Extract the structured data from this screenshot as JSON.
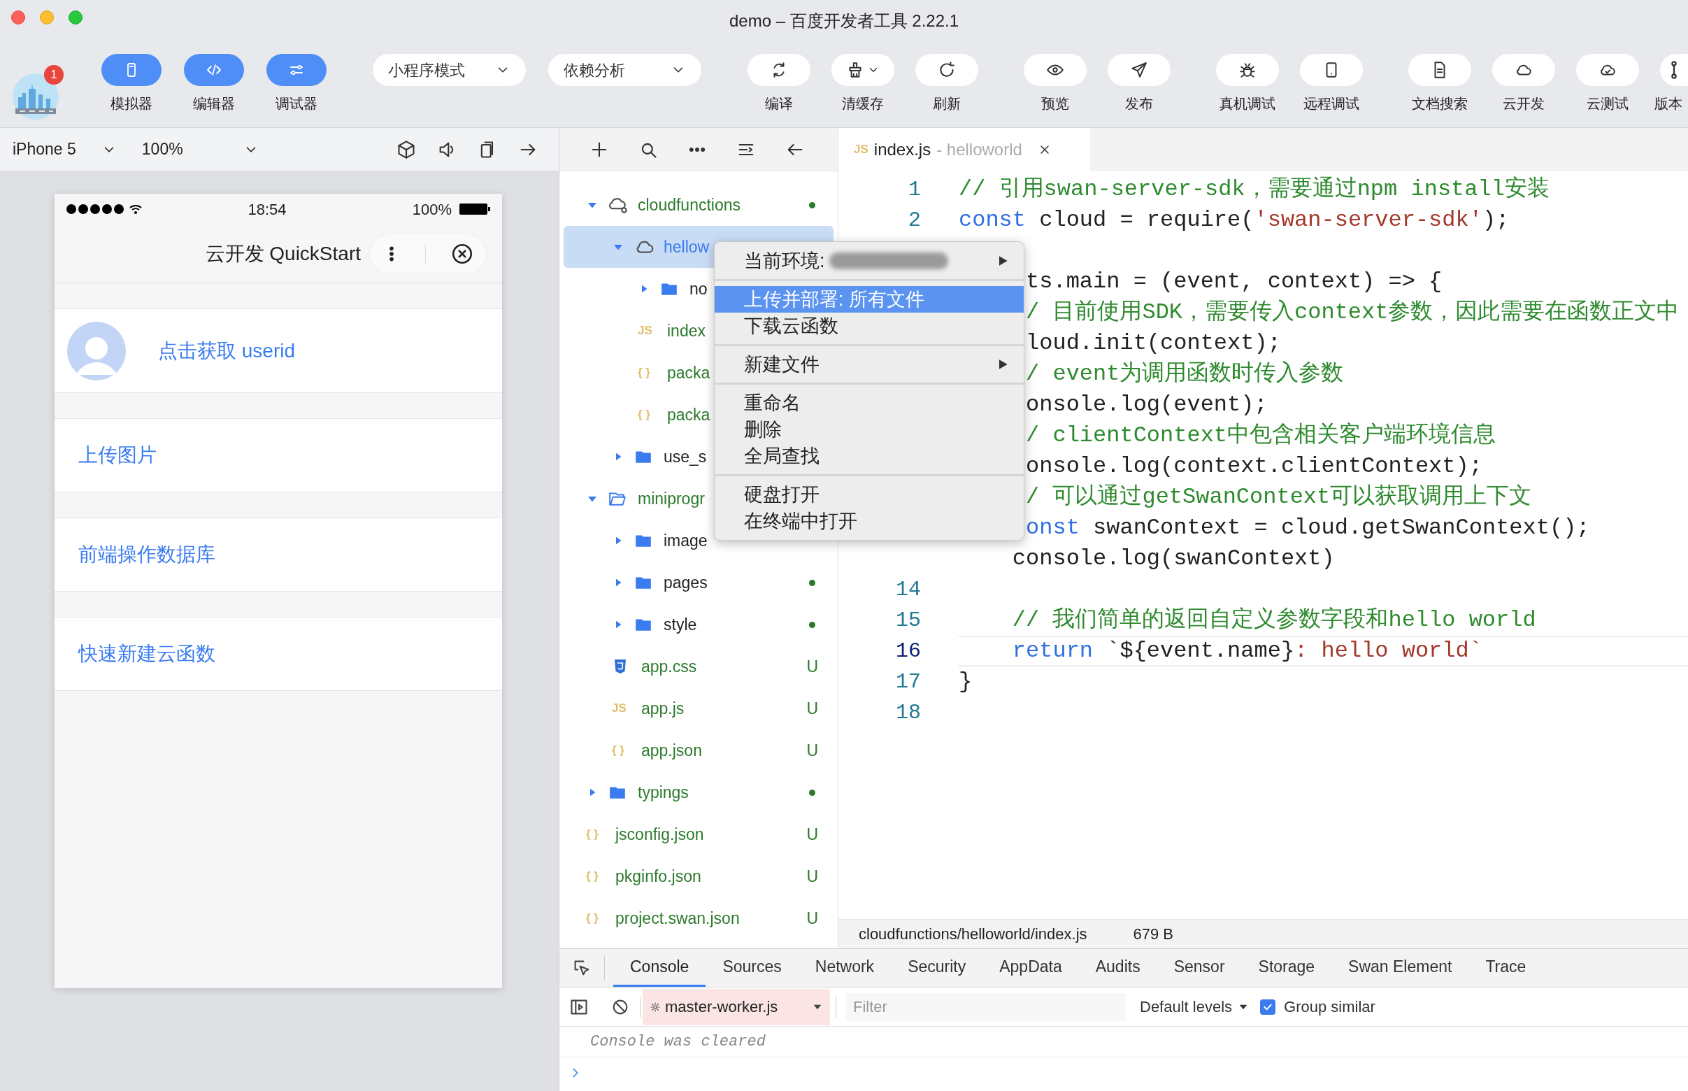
{
  "window": {
    "title": "demo – 百度开发者工具 2.22.1"
  },
  "toolbar": {
    "avatar_badge": "1",
    "toggles": [
      {
        "label": "模拟器",
        "on": true
      },
      {
        "label": "编辑器",
        "on": true
      },
      {
        "label": "调试器",
        "on": true
      }
    ],
    "dropdowns": [
      {
        "label": "小程序模式"
      },
      {
        "label": "依赖分析"
      }
    ],
    "action_groups": [
      [
        {
          "label": "编译"
        },
        {
          "label": "清缓存",
          "dropdown": true
        },
        {
          "label": "刷新"
        }
      ],
      [
        {
          "label": "预览"
        },
        {
          "label": "发布"
        }
      ],
      [
        {
          "label": "真机调试"
        },
        {
          "label": "远程调试"
        }
      ],
      [
        {
          "label": "文档搜索"
        },
        {
          "label": "云开发"
        },
        {
          "label": "云测试"
        },
        {
          "label": "版本"
        }
      ]
    ]
  },
  "simulator": {
    "device": "iPhone 5",
    "zoom": "100%",
    "phone": {
      "time": "18:54",
      "battery": "100%",
      "nav_title": "云开发 QuickStart",
      "cells": [
        {
          "kind": "user",
          "label": "点击获取 userid"
        },
        {
          "kind": "link",
          "label": "上传图片"
        },
        {
          "kind": "link",
          "label": "前端操作数据库"
        },
        {
          "kind": "link",
          "label": "快速新建云函数"
        }
      ]
    }
  },
  "file_tree": {
    "items": [
      {
        "name": "cloudfunctions",
        "kind": "cloud-root",
        "expanded": true,
        "selected": false,
        "untracked": true,
        "dot": true,
        "children": [
          {
            "name": "hellow",
            "kind": "cloud",
            "expanded": true,
            "selected": true,
            "dot": false,
            "children": [
              {
                "name": "no",
                "kind": "folder",
                "expanded": false,
                "selected": false,
                "untracked": false,
                "dot": false
              },
              {
                "name": "index",
                "kind": "file",
                "glyph": "JS",
                "selected": false,
                "untracked": true,
                "dot": false
              },
              {
                "name": "packa",
                "kind": "file",
                "glyph": "{ }",
                "selected": false,
                "untracked": true,
                "dot": false
              },
              {
                "name": "packa",
                "kind": "file",
                "glyph": "{ }",
                "selected": false,
                "untracked": true,
                "dot": false
              }
            ]
          },
          {
            "name": "use_s",
            "kind": "folder",
            "expanded": false,
            "selected": false,
            "untracked": false,
            "dot": false
          }
        ]
      },
      {
        "name": "miniprogr",
        "kind": "folder",
        "expanded": true,
        "selected": false,
        "untracked": true,
        "dot": false,
        "children": [
          {
            "name": "image",
            "kind": "folder",
            "expanded": false,
            "selected": false,
            "untracked": false,
            "dot": false
          },
          {
            "name": "pages",
            "kind": "folder",
            "expanded": false,
            "selected": false,
            "untracked": false,
            "dot": true
          },
          {
            "name": "style",
            "kind": "folder",
            "expanded": false,
            "selected": false,
            "untracked": false,
            "dot": true
          },
          {
            "name": "app.css",
            "kind": "css",
            "selected": false,
            "untracked": true,
            "dot": false,
            "badge": "U"
          },
          {
            "name": "app.js",
            "kind": "file",
            "glyph": "JS",
            "selected": false,
            "untracked": true,
            "dot": false,
            "badge": "U"
          },
          {
            "name": "app.json",
            "kind": "file",
            "glyph": "{ }",
            "selected": false,
            "untracked": true,
            "dot": false,
            "badge": "U"
          }
        ]
      },
      {
        "name": "typings",
        "kind": "folder",
        "expanded": false,
        "selected": false,
        "untracked": true,
        "dot": true
      },
      {
        "name": "jsconfig.json",
        "kind": "file",
        "glyph": "{ }",
        "selected": false,
        "untracked": true,
        "dot": false,
        "badge": "U"
      },
      {
        "name": "pkginfo.json",
        "kind": "file",
        "glyph": "{ }",
        "selected": false,
        "untracked": true,
        "dot": false,
        "badge": "U"
      },
      {
        "name": "project.swan.json",
        "kind": "file",
        "glyph": "{ }",
        "selected": false,
        "untracked": true,
        "dot": false,
        "badge": "U"
      }
    ]
  },
  "context_menu": {
    "groups": [
      {
        "items": [
          {
            "label": "当前环境:",
            "selected": false,
            "submenu": true,
            "redacted": true
          }
        ]
      },
      {
        "items": [
          {
            "label": "上传并部署: 所有文件",
            "selected": true,
            "submenu": false,
            "redacted": false
          },
          {
            "label": "下载云函数",
            "selected": false,
            "submenu": false,
            "redacted": false
          }
        ]
      },
      {
        "items": [
          {
            "label": "新建文件",
            "selected": false,
            "submenu": true,
            "redacted": false
          }
        ]
      },
      {
        "items": [
          {
            "label": "重命名",
            "selected": false,
            "submenu": false,
            "redacted": false
          },
          {
            "label": "删除",
            "selected": false,
            "submenu": false,
            "redacted": false
          },
          {
            "label": "全局查找",
            "selected": false,
            "submenu": false,
            "redacted": false
          }
        ]
      },
      {
        "items": [
          {
            "label": "硬盘打开",
            "selected": false,
            "submenu": false,
            "redacted": false
          },
          {
            "label": "在终端中打开",
            "selected": false,
            "submenu": false,
            "redacted": false
          }
        ]
      }
    ]
  },
  "editor": {
    "tab": {
      "glyph": "JS",
      "file": "index.js",
      "suffix": "- helloworld"
    },
    "lines": [
      {
        "kind": "code",
        "number": "1",
        "current": false,
        "tokens": [
          {
            "kind": "comment",
            "text": "// 引用swan-server-sdk，需要通过npm install安装"
          }
        ]
      },
      {
        "kind": "code",
        "number": "2",
        "current": false,
        "tokens": [
          {
            "kind": "keyword",
            "text": "const"
          },
          {
            "kind": "plain",
            "text": " cloud = require("
          },
          {
            "kind": "string",
            "text": "'swan-server-sdk'"
          },
          {
            "kind": "plain",
            "text": ");"
          }
        ]
      },
      {
        "kind": "covered",
        "current": false
      },
      {
        "kind": "covered",
        "current": false,
        "tokens": [
          {
            "kind": "plain",
            "text": "ts.main = (event, context) => {"
          }
        ]
      },
      {
        "kind": "covered",
        "current": false,
        "tokens": [
          {
            "kind": "comment",
            "text": "/ 目前使用SDK，需要传入context参数，因此需要在函数正文中"
          }
        ]
      },
      {
        "kind": "covered",
        "current": false,
        "tokens": [
          {
            "kind": "plain",
            "text": "loud.init(context);"
          }
        ]
      },
      {
        "kind": "covered",
        "current": false,
        "tokens": [
          {
            "kind": "comment",
            "text": "/ event为调用函数时传入参数"
          }
        ]
      },
      {
        "kind": "covered",
        "current": false,
        "tokens": [
          {
            "kind": "plain",
            "text": "onsole.log(event);"
          }
        ]
      },
      {
        "kind": "covered",
        "current": false,
        "tokens": [
          {
            "kind": "comment",
            "text": "/ clientContext中包含相关客户端环境信息"
          }
        ]
      },
      {
        "kind": "covered",
        "current": false,
        "tokens": [
          {
            "kind": "plain",
            "text": "onsole.log(context.clientContext);"
          }
        ]
      },
      {
        "kind": "covered",
        "current": false,
        "tokens": [
          {
            "kind": "comment",
            "text": "/ 可以通过getSwanContext可以获取调用上下文"
          }
        ]
      },
      {
        "kind": "covered",
        "current": false,
        "tokens": [
          {
            "kind": "keyword",
            "text": "onst"
          },
          {
            "kind": "plain",
            "text": " swanContext = cloud.getSwanContext();"
          }
        ]
      },
      {
        "kind": "code",
        "current": false,
        "tokens": [
          {
            "kind": "plain",
            "text": "    console.log(swanContext)"
          }
        ]
      },
      {
        "kind": "code",
        "number": "14",
        "current": false
      },
      {
        "kind": "code",
        "number": "15",
        "current": false,
        "tokens": [
          {
            "kind": "comment",
            "text": "    // 我们简单的返回自定义参数字段和hello world"
          }
        ]
      },
      {
        "kind": "code",
        "number": "16",
        "current": true,
        "tokens": [
          {
            "kind": "keyword",
            "text": "    return"
          },
          {
            "kind": "plain",
            "text": " `${event.name}"
          },
          {
            "kind": "string",
            "text": ": hello world`"
          }
        ]
      },
      {
        "kind": "code",
        "number": "17",
        "current": false,
        "tokens": [
          {
            "kind": "plain",
            "text": "}"
          }
        ]
      },
      {
        "kind": "code",
        "number": "18",
        "current": false
      }
    ],
    "status": {
      "path": "cloudfunctions/helloworld/index.js",
      "size": "679 B"
    }
  },
  "devtools": {
    "tabs": [
      {
        "label": "Console",
        "selected": true
      },
      {
        "label": "Sources",
        "selected": false
      },
      {
        "label": "Network",
        "selected": false
      },
      {
        "label": "Security",
        "selected": false
      },
      {
        "label": "AppData",
        "selected": false
      },
      {
        "label": "Audits",
        "selected": false
      },
      {
        "label": "Sensor",
        "selected": false
      },
      {
        "label": "Storage",
        "selected": false
      },
      {
        "label": "Swan Element",
        "selected": false
      },
      {
        "label": "Trace",
        "selected": false
      }
    ],
    "context": "master-worker.js",
    "filter_placeholder": "Filter",
    "levels": "Default levels",
    "group_similar": {
      "label": "Group similar",
      "checked": true
    },
    "messages": [
      "Console was cleared"
    ]
  }
}
